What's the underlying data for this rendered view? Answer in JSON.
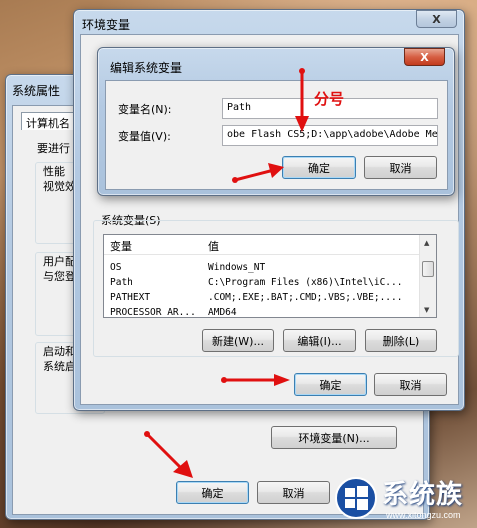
{
  "annotation": {
    "semicolon_note": "分号"
  },
  "sysprops": {
    "title": "系统属性",
    "tab": "计算机名",
    "intro": "要进行",
    "perf_title": "性能",
    "perf_text": "视觉效",
    "profile_title": "用户配",
    "profile_text": "与您登",
    "startup_title": "启动和",
    "startup_text": "系统启",
    "env_button": "环境变量(N)...",
    "ok": "确定",
    "cancel": "取消"
  },
  "envvars": {
    "title": "环境变量",
    "close": "X",
    "system_group_label": "系统变量(S)",
    "col_var": "变量",
    "col_val": "值",
    "rows": [
      {
        "var": "OS",
        "val": "Windows_NT"
      },
      {
        "var": "Path",
        "val": "C:\\Program Files (x86)\\Intel\\iC..."
      },
      {
        "var": "PATHEXT",
        "val": ".COM;.EXE;.BAT;.CMD;.VBS;.VBE;...."
      },
      {
        "var": "PROCESSOR_AR...",
        "val": "AMD64"
      }
    ],
    "new_button": "新建(W)...",
    "edit_button": "编辑(I)...",
    "delete_button": "删除(L)",
    "ok": "确定",
    "cancel": "取消"
  },
  "editdialog": {
    "title": "编辑系统变量",
    "close": "X",
    "name_label": "变量名(N):",
    "value_label": "变量值(V):",
    "name_value": "Path",
    "value_value": "obe Flash CS5;D:\\app\\adobe\\Adobe Med",
    "ok": "确定",
    "cancel": "取消"
  },
  "watermark": {
    "text": "系统族",
    "url": "www.xitongzu.com"
  },
  "colors": {
    "annotation_red": "#e01010",
    "aero_frame": "#b3c9e2",
    "dialog_bg": "#f0f0f0"
  }
}
